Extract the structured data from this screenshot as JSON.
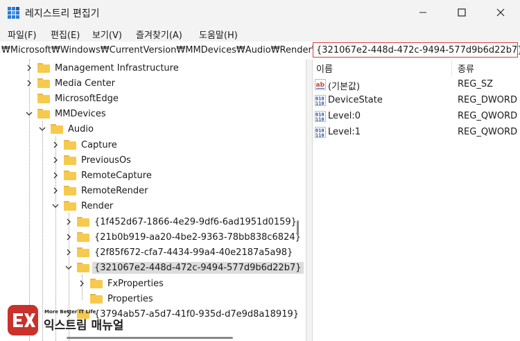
{
  "window": {
    "title": "레지스트리 편집기",
    "icons": {
      "app": "registry-editor-icon",
      "minimize": "minimize-icon",
      "maximize": "maximize-icon",
      "close": "close-icon"
    }
  },
  "menu": {
    "items": [
      {
        "label": "파일(F)"
      },
      {
        "label": "편집(E)"
      },
      {
        "label": "보기(V)"
      },
      {
        "label": "즐겨찾기(A)"
      },
      {
        "label": "도움말(H)"
      }
    ]
  },
  "address": {
    "path_prefix": "₩Microsoft₩Windows₩CurrentVersion₩MMDevices₩Audio₩Render₩",
    "path_highlight": "{321067e2-448d-472c-9494-577d9b6d22b7}",
    "highlight_color": "#e0353b"
  },
  "tree": {
    "items": [
      {
        "label": "Management Infrastructure",
        "expanded": false
      },
      {
        "label": "Media Center",
        "expanded": false
      },
      {
        "label": "MicrosoftEdge",
        "expanded": null
      },
      {
        "label": "MMDevices",
        "expanded": true
      },
      {
        "label": "Audio",
        "expanded": true
      },
      {
        "label": "Capture",
        "expanded": false
      },
      {
        "label": "PreviousOs",
        "expanded": false
      },
      {
        "label": "RemoteCapture",
        "expanded": false
      },
      {
        "label": "RemoteRender",
        "expanded": false
      },
      {
        "label": "Render",
        "expanded": true
      },
      {
        "label": "{1f452d67-1866-4e29-9df6-6ad1951d0159}",
        "expanded": false
      },
      {
        "label": "{21b0b919-aa20-4be2-9363-78bb838c6824}",
        "expanded": false
      },
      {
        "label": "{2f85f672-cfa7-4434-99a4-40e2187a5a98}",
        "expanded": false
      },
      {
        "label": "{321067e2-448d-472c-9494-577d9b6d22b7}",
        "expanded": true,
        "selected": true
      },
      {
        "label": "FxProperties",
        "expanded": false
      },
      {
        "label": "Properties",
        "expanded": null
      },
      {
        "label": "{3794ab57-a5d7-41f0-935d-d7e9d8a18919}",
        "expanded": false
      }
    ]
  },
  "values": {
    "columns": {
      "name": "이름",
      "type": "종류"
    },
    "rows": [
      {
        "name": "(기본값)",
        "type": "REG_SZ",
        "icon": "string-value-icon"
      },
      {
        "name": "DeviceState",
        "type": "REG_DWORD",
        "icon": "binary-value-icon"
      },
      {
        "name": "Level:0",
        "type": "REG_QWORD",
        "icon": "binary-value-icon"
      },
      {
        "name": "Level:1",
        "type": "REG_QWORD",
        "icon": "binary-value-icon"
      }
    ]
  },
  "watermark": {
    "tagline": "More Better IT Life",
    "brand": "익스트림 매뉴얼",
    "color": "#c9312b"
  }
}
